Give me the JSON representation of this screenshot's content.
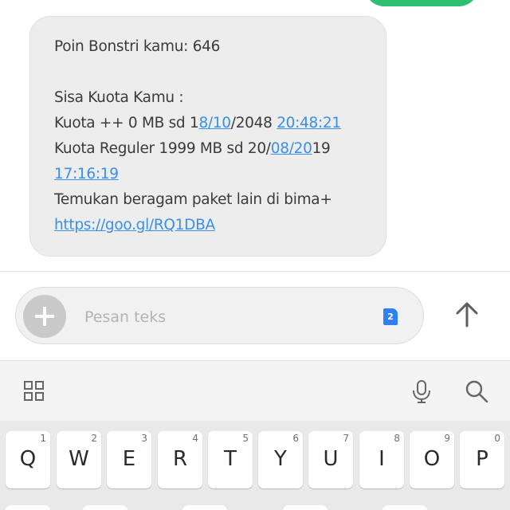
{
  "message": {
    "lines": [
      [
        {
          "text": "Poin Bonstri kamu: 646"
        }
      ],
      [],
      [
        {
          "text": "Sisa Kuota Kamu :"
        }
      ],
      [
        {
          "text": "Kuota ++ 0 MB sd 1"
        },
        {
          "text": "8/10",
          "link": true
        },
        {
          "text": "/2048 "
        },
        {
          "text": "20:48:21",
          "link": true
        }
      ],
      [
        {
          "text": "Kuota Reguler 1999 MB sd 20/"
        },
        {
          "text": "08/20",
          "link": true
        },
        {
          "text": "19"
        }
      ],
      [
        {
          "text": "17:16:19",
          "link": true
        }
      ],
      [
        {
          "text": "Temukan beragam paket lain di bima+"
        }
      ],
      [
        {
          "text": "https://goo.gl/RQ1DBA",
          "link": true
        }
      ]
    ]
  },
  "compose": {
    "placeholder": "Pesan teks",
    "sim_badge": "2"
  },
  "icons": {
    "add": "plus-icon",
    "send": "arrow-up-icon",
    "apps": "grid-icon",
    "mic": "microphone-icon",
    "search": "search-icon"
  },
  "keyboard": {
    "row1": [
      {
        "letter": "Q",
        "num": "1"
      },
      {
        "letter": "W",
        "num": "2"
      },
      {
        "letter": "E",
        "num": "3"
      },
      {
        "letter": "R",
        "num": "4"
      },
      {
        "letter": "T",
        "num": "5"
      },
      {
        "letter": "Y",
        "num": "6"
      },
      {
        "letter": "U",
        "num": "7"
      },
      {
        "letter": "I",
        "num": "8"
      },
      {
        "letter": "O",
        "num": "9"
      },
      {
        "letter": "P",
        "num": "0"
      }
    ]
  },
  "colors": {
    "sent_bubble": "#2fbf71",
    "link": "#3c8fe6",
    "sim_badge": "#2f80f5"
  }
}
